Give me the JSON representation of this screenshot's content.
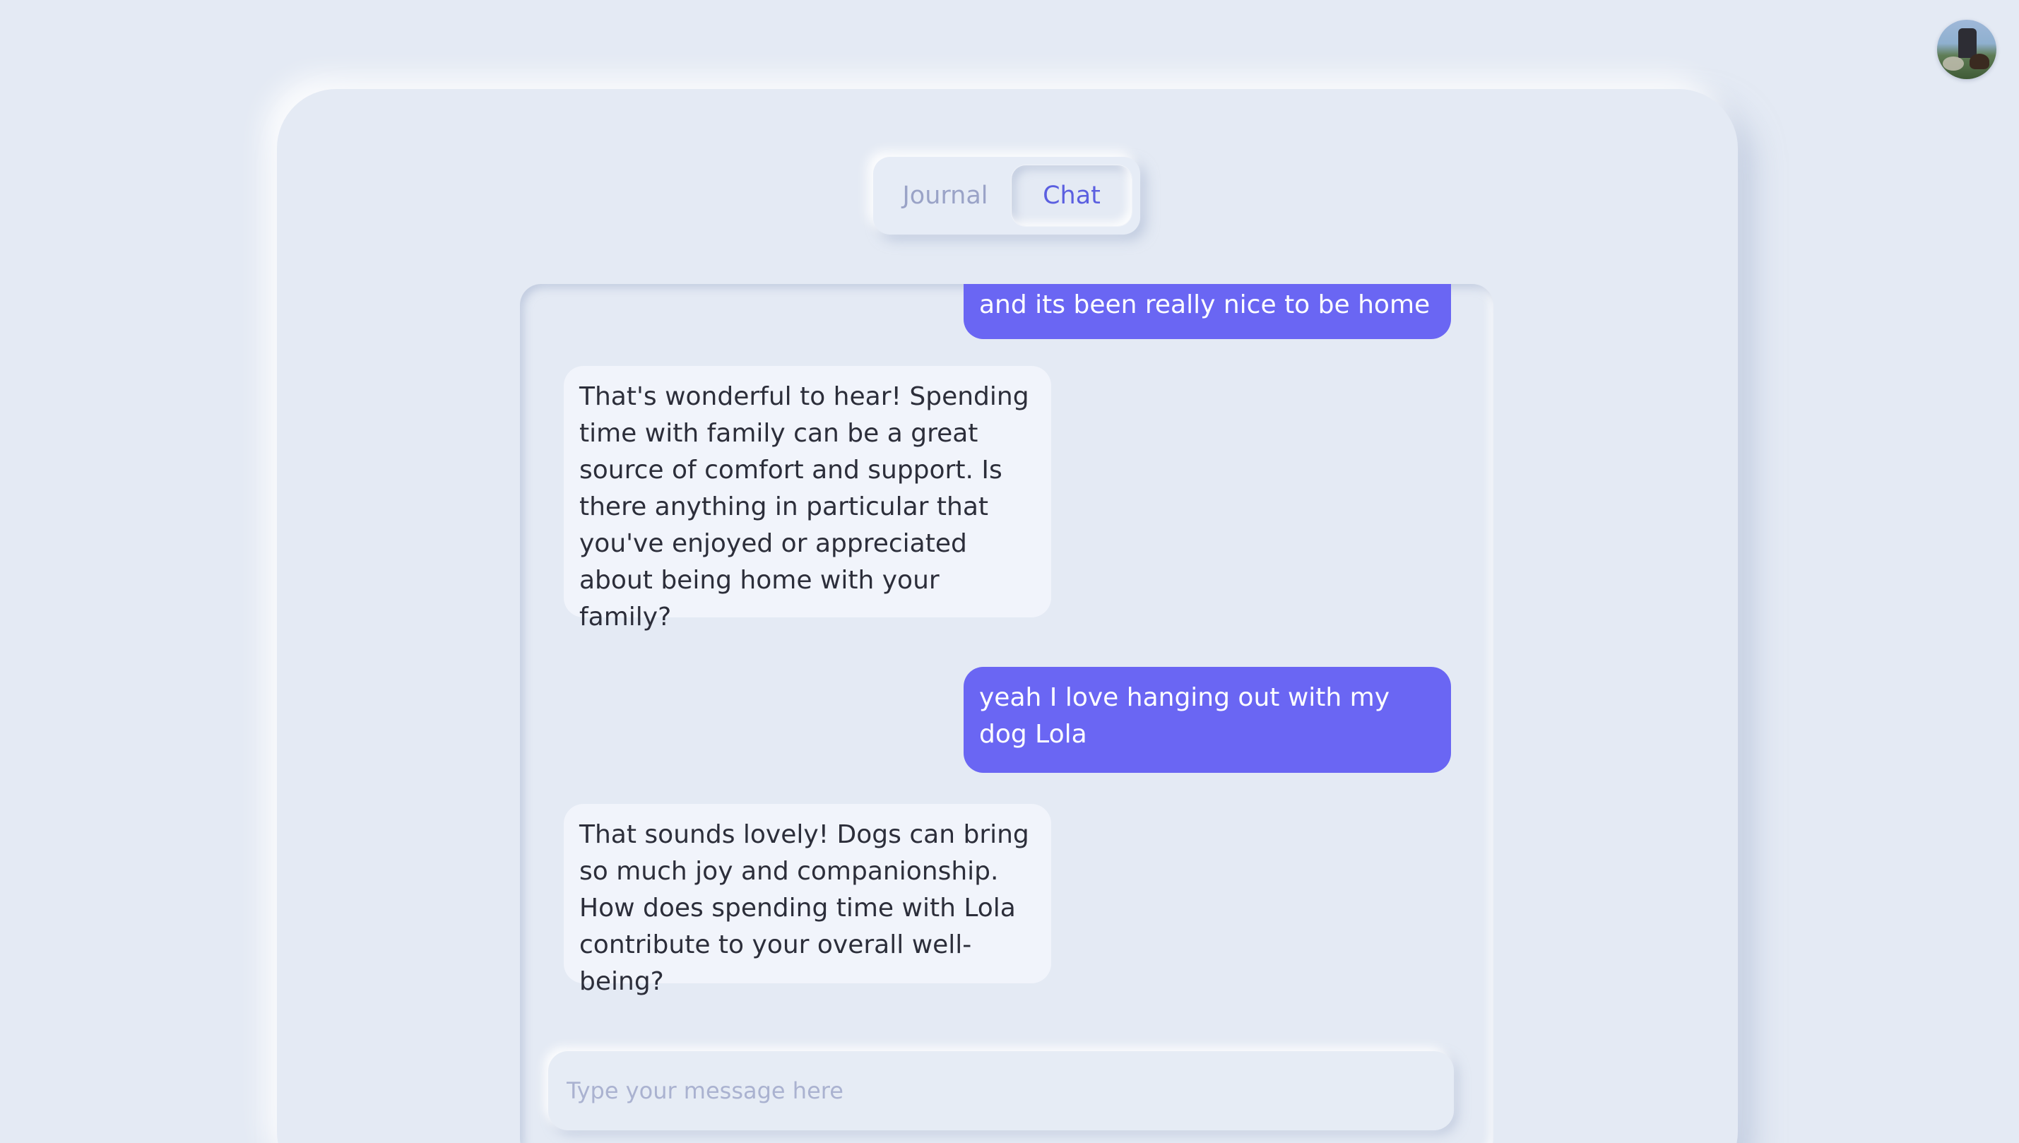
{
  "app": {
    "accent_color": "#6a66f3",
    "background_color": "#e4eaf4"
  },
  "header": {
    "avatar_icon": "user-avatar-photo"
  },
  "tabs": [
    {
      "label": "Journal",
      "active": false
    },
    {
      "label": "Chat",
      "active": true
    }
  ],
  "chat": {
    "messages": [
      {
        "role": "user",
        "text": "and its been really nice to be home"
      },
      {
        "role": "assistant",
        "text": "That's wonderful to hear! Spending time with family can be a great source of comfort and support. Is there anything in particular that you've enjoyed or appreciated about being home with your family?"
      },
      {
        "role": "user",
        "text": "yeah I love hanging out with my dog Lola"
      },
      {
        "role": "assistant",
        "text": "That sounds lovely! Dogs can bring so much joy and companionship. How does spending time with Lola contribute to your overall well-being?"
      }
    ],
    "input": {
      "value": "",
      "placeholder": "Type your message here"
    }
  }
}
